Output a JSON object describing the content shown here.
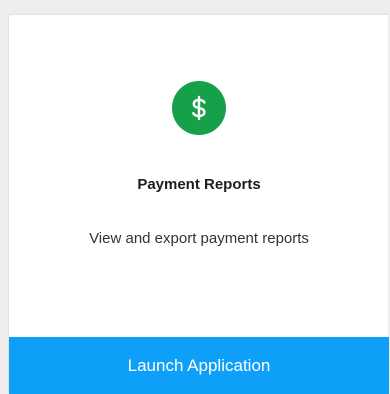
{
  "card": {
    "icon": "dollar-icon",
    "icon_color": "#17a04a",
    "title": "Payment Reports",
    "description": "View and export payment reports",
    "button_label": "Launch Application",
    "button_color": "#0ea0f8"
  }
}
